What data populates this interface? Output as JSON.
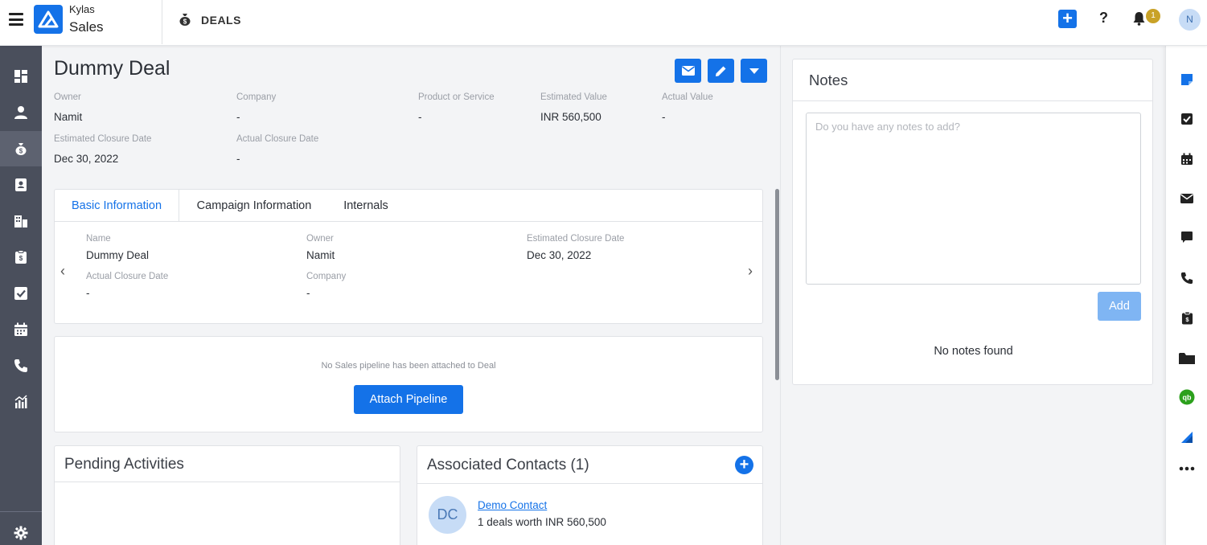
{
  "topbar": {
    "brand_name": "Kylas",
    "brand_product": "Sales",
    "module_title": "DEALS",
    "help_label": "?",
    "notification_count": "1",
    "user_initial": "N"
  },
  "sidebar": {
    "items": [
      {
        "icon": "dashboard-icon"
      },
      {
        "icon": "user-icon"
      },
      {
        "icon": "money-bag-icon",
        "active": true
      },
      {
        "icon": "contact-card-icon"
      },
      {
        "icon": "building-icon"
      },
      {
        "icon": "quote-icon"
      },
      {
        "icon": "checkbox-icon"
      },
      {
        "icon": "calendar-icon"
      },
      {
        "icon": "phone-icon"
      },
      {
        "icon": "report-chart-icon"
      },
      {
        "icon": "gear-icon"
      }
    ]
  },
  "deal": {
    "title": "Dummy Deal",
    "summary": {
      "owner_label": "Owner",
      "owner_value": "Namit",
      "company_label": "Company",
      "company_value": "-",
      "product_label": "Product or Service",
      "product_value": "-",
      "est_value_label": "Estimated Value",
      "est_value_value": "INR 560,500",
      "actual_value_label": "Actual Value",
      "actual_value_value": "-",
      "est_close_label": "Estimated Closure Date",
      "est_close_value": "Dec 30, 2022",
      "actual_close_label": "Actual Closure Date",
      "actual_close_value": "-"
    }
  },
  "tabs": [
    {
      "label": "Basic Information",
      "active": true
    },
    {
      "label": "Campaign Information",
      "active": false
    },
    {
      "label": "Internals",
      "active": false
    }
  ],
  "basic_info": {
    "name_label": "Name",
    "name_value": "Dummy Deal",
    "owner_label": "Owner",
    "owner_value": "Namit",
    "est_close_label": "Estimated Closure Date",
    "est_close_value": "Dec 30, 2022",
    "actual_close_label": "Actual Closure Date",
    "actual_close_value": "-",
    "company_label": "Company",
    "company_value": "-"
  },
  "pipeline": {
    "empty_text": "No Sales pipeline has been attached to Deal",
    "attach_label": "Attach Pipeline"
  },
  "pending_activities": {
    "title": "Pending Activities"
  },
  "associated_contacts": {
    "title": "Associated Contacts (1)",
    "contacts": [
      {
        "initials": "DC",
        "name": "Demo Contact",
        "subtitle": "1 deals worth INR 560,500"
      }
    ]
  },
  "notes": {
    "title": "Notes",
    "placeholder": "Do you have any notes to add?",
    "add_label": "Add",
    "empty_text": "No notes found"
  },
  "right_rail": {
    "items": [
      "note-icon",
      "task-icon",
      "calendar-icon",
      "email-icon",
      "chat-icon",
      "phone-icon",
      "quote-icon",
      "folder-icon",
      "quickbooks-icon",
      "sales-app-icon",
      "more-icon"
    ],
    "quickbooks_text": "qb"
  },
  "colors": {
    "accent": "#1472e8",
    "sidebar": "#4a4f5c",
    "badge": "#c9a227"
  }
}
